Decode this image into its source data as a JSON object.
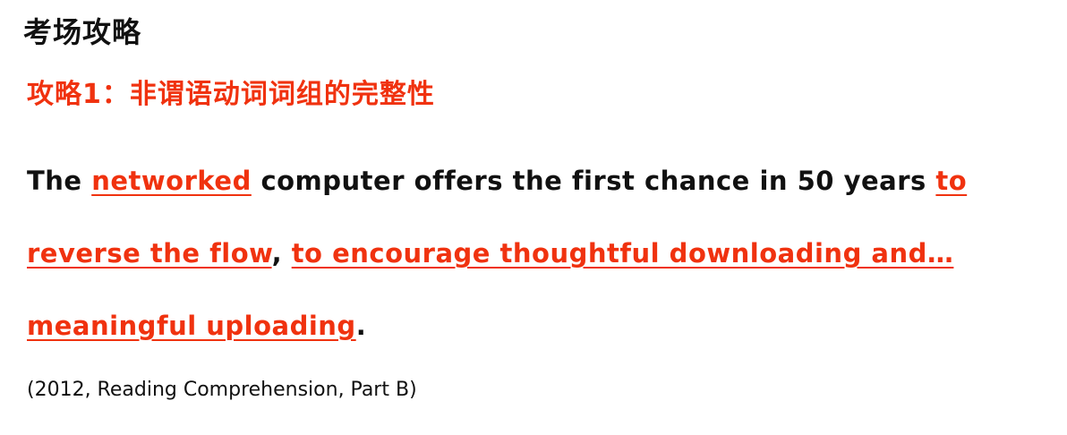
{
  "heading": "考场攻略",
  "strategy": "攻略1：非谓语动词词组的完整性",
  "sentence": {
    "line1": {
      "t1": "The ",
      "h1": "networked",
      "t2": " computer offers the first chance in 50 years ",
      "h2": "to"
    },
    "line2": {
      "h1": "reverse the flow",
      "t1": ", ",
      "h2": "to encourage thoughtful downloading and…"
    },
    "line3": {
      "h1": "meaningful uploading",
      "t1": "."
    }
  },
  "source": "(2012, Reading Comprehension, Part B)",
  "colors": {
    "accent": "#f0320f",
    "text": "#111111",
    "background": "#ffffff"
  }
}
